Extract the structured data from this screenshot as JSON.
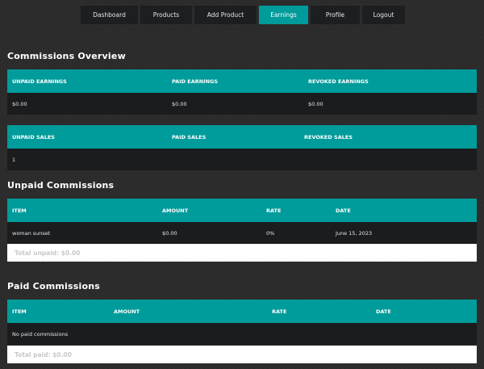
{
  "nav": {
    "items": [
      {
        "label": "Dashboard"
      },
      {
        "label": "Products"
      },
      {
        "label": "Add Product"
      },
      {
        "label": "Earnings",
        "active": true
      },
      {
        "label": "Profile"
      },
      {
        "label": "Logout"
      }
    ]
  },
  "overview": {
    "title": "Commissions Overview",
    "earnings": {
      "headers": [
        "UNPAID EARNINGS",
        "PAID EARNINGS",
        "REVOKED EARNINGS"
      ],
      "values": [
        "$0.00",
        "$0.00",
        "$0.00"
      ]
    },
    "sales": {
      "headers": [
        "UNPAID SALES",
        "PAID SALES",
        "REVOKED SALES"
      ],
      "values": [
        "1",
        "",
        ""
      ]
    }
  },
  "unpaid": {
    "title": "Unpaid Commissions",
    "headers": [
      "ITEM",
      "AMOUNT",
      "RATE",
      "DATE"
    ],
    "rows": [
      [
        "woman sunset",
        "$0.00",
        "0%",
        "June 15, 2023"
      ]
    ],
    "total": "Total unpaid: $0.00"
  },
  "paid": {
    "title": "Paid Commissions",
    "headers": [
      "ITEM",
      "AMOUNT",
      "RATE",
      "DATE"
    ],
    "empty_text": "No paid commissions",
    "total": "Total paid: $0.00"
  },
  "colors": {
    "accent": "#009b9b",
    "row_bg": "#1b1c1e",
    "page_bg": "#2b2b2b"
  }
}
